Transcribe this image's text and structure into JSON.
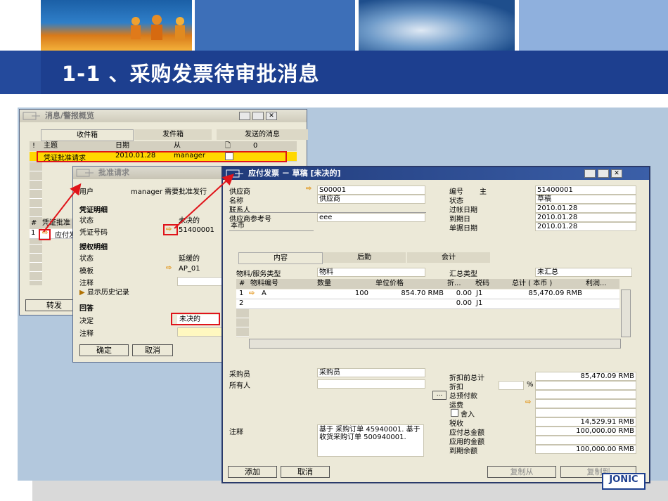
{
  "slide": {
    "title": "1-1 、采购发票待审批消息",
    "logo_text": "JONIC"
  },
  "msg_window": {
    "title": "消息/警报概览",
    "tabs": [
      "收件箱",
      "发件箱",
      "发送的消息"
    ],
    "columns": [
      "!",
      "主题",
      "日期",
      "从",
      "🗋",
      "0"
    ],
    "row": {
      "subject": "凭证批准请求",
      "date": "2010.01.28",
      "from": "manager"
    },
    "sub_header": [
      "#",
      "凭证批准"
    ],
    "sub_row": {
      "num": "1",
      "text": "应付发"
    },
    "forward_button": "转发"
  },
  "approve_window": {
    "title": "批准请求",
    "user_label": "用户",
    "user_value": "manager 需要批准发行",
    "section_doc": "凭证明细",
    "status_label": "状态",
    "status_value": "未决的",
    "docnum_label": "凭证号码",
    "docnum_value": "51400001",
    "section_auth": "授权明细",
    "auth_status_label": "状态",
    "auth_status_value": "延缓的",
    "template_label": "模板",
    "template_value": "AP_01",
    "remark_label": "注释",
    "history_link": "显示历史记录",
    "section_reply": "回答",
    "decision_label": "决定",
    "decision_value": "未决的",
    "reply_remark_label": "注释",
    "ok_button": "确定",
    "cancel_button": "取消"
  },
  "invoice_window": {
    "title": "应付发票 － 草稿 [未决的]",
    "vendor_label": "供应商",
    "vendor_value": "S00001",
    "name_label": "名称",
    "name_value": "供应商",
    "contact_label": "联系人",
    "vendor_ref_label": "供应商参考号",
    "vendor_ref_value": "eee",
    "currency_value": "本币",
    "docno_label": "编号",
    "docno_series": "主",
    "docno_value": "51400001",
    "status_label": "状态",
    "status_value": "草稿",
    "posting_label": "过帐日期",
    "posting_value": "2010.01.28",
    "due_label": "到期日",
    "due_value": "2010.01.28",
    "docdate_label": "单据日期",
    "docdate_value": "2010.01.28",
    "tabs": [
      "内容",
      "后勤",
      "会计"
    ],
    "item_type_label": "物料/服务类型",
    "item_type_value": "物料",
    "summary_label": "汇总类型",
    "summary_value": "未汇总",
    "grid_headers": [
      "#",
      "物料编号",
      "数量",
      "单位价格",
      "折...",
      "税码",
      "总计 ( 本币 )",
      "利润..."
    ],
    "rows": [
      {
        "num": "1",
        "item": "A",
        "qty": "100",
        "price": "854.70 RMB",
        "disc": "0.00",
        "tax": "J1",
        "total": "85,470.09 RMB"
      },
      {
        "num": "2",
        "item": "",
        "qty": "",
        "price": "",
        "disc": "0.00",
        "tax": "J1",
        "total": ""
      }
    ],
    "buyer_label": "采购员",
    "buyer_value": "采购员",
    "owner_label": "所有人",
    "remark_label": "注释",
    "remark_value": "基于 采购订单 45940001. 基于 收货采购订单 500940001.",
    "totals": [
      {
        "label": "折扣前总计",
        "value": "85,470.09 RMB"
      },
      {
        "label": "折扣",
        "value": ""
      },
      {
        "label": "总预付款",
        "value": ""
      },
      {
        "label": "运费",
        "value": ""
      },
      {
        "label": "舍入",
        "value": ""
      },
      {
        "label": "税收",
        "value": "14,529.91 RMB"
      },
      {
        "label": "应付总金额",
        "value": "100,000.00 RMB"
      },
      {
        "label": "应用的金额",
        "value": ""
      },
      {
        "label": "到期余额",
        "value": "100,000.00 RMB"
      }
    ],
    "percent_sign": "%",
    "add_button": "添加",
    "cancel_button": "取消",
    "copy_from_button": "复制从",
    "copy_to_button": "复制到"
  }
}
